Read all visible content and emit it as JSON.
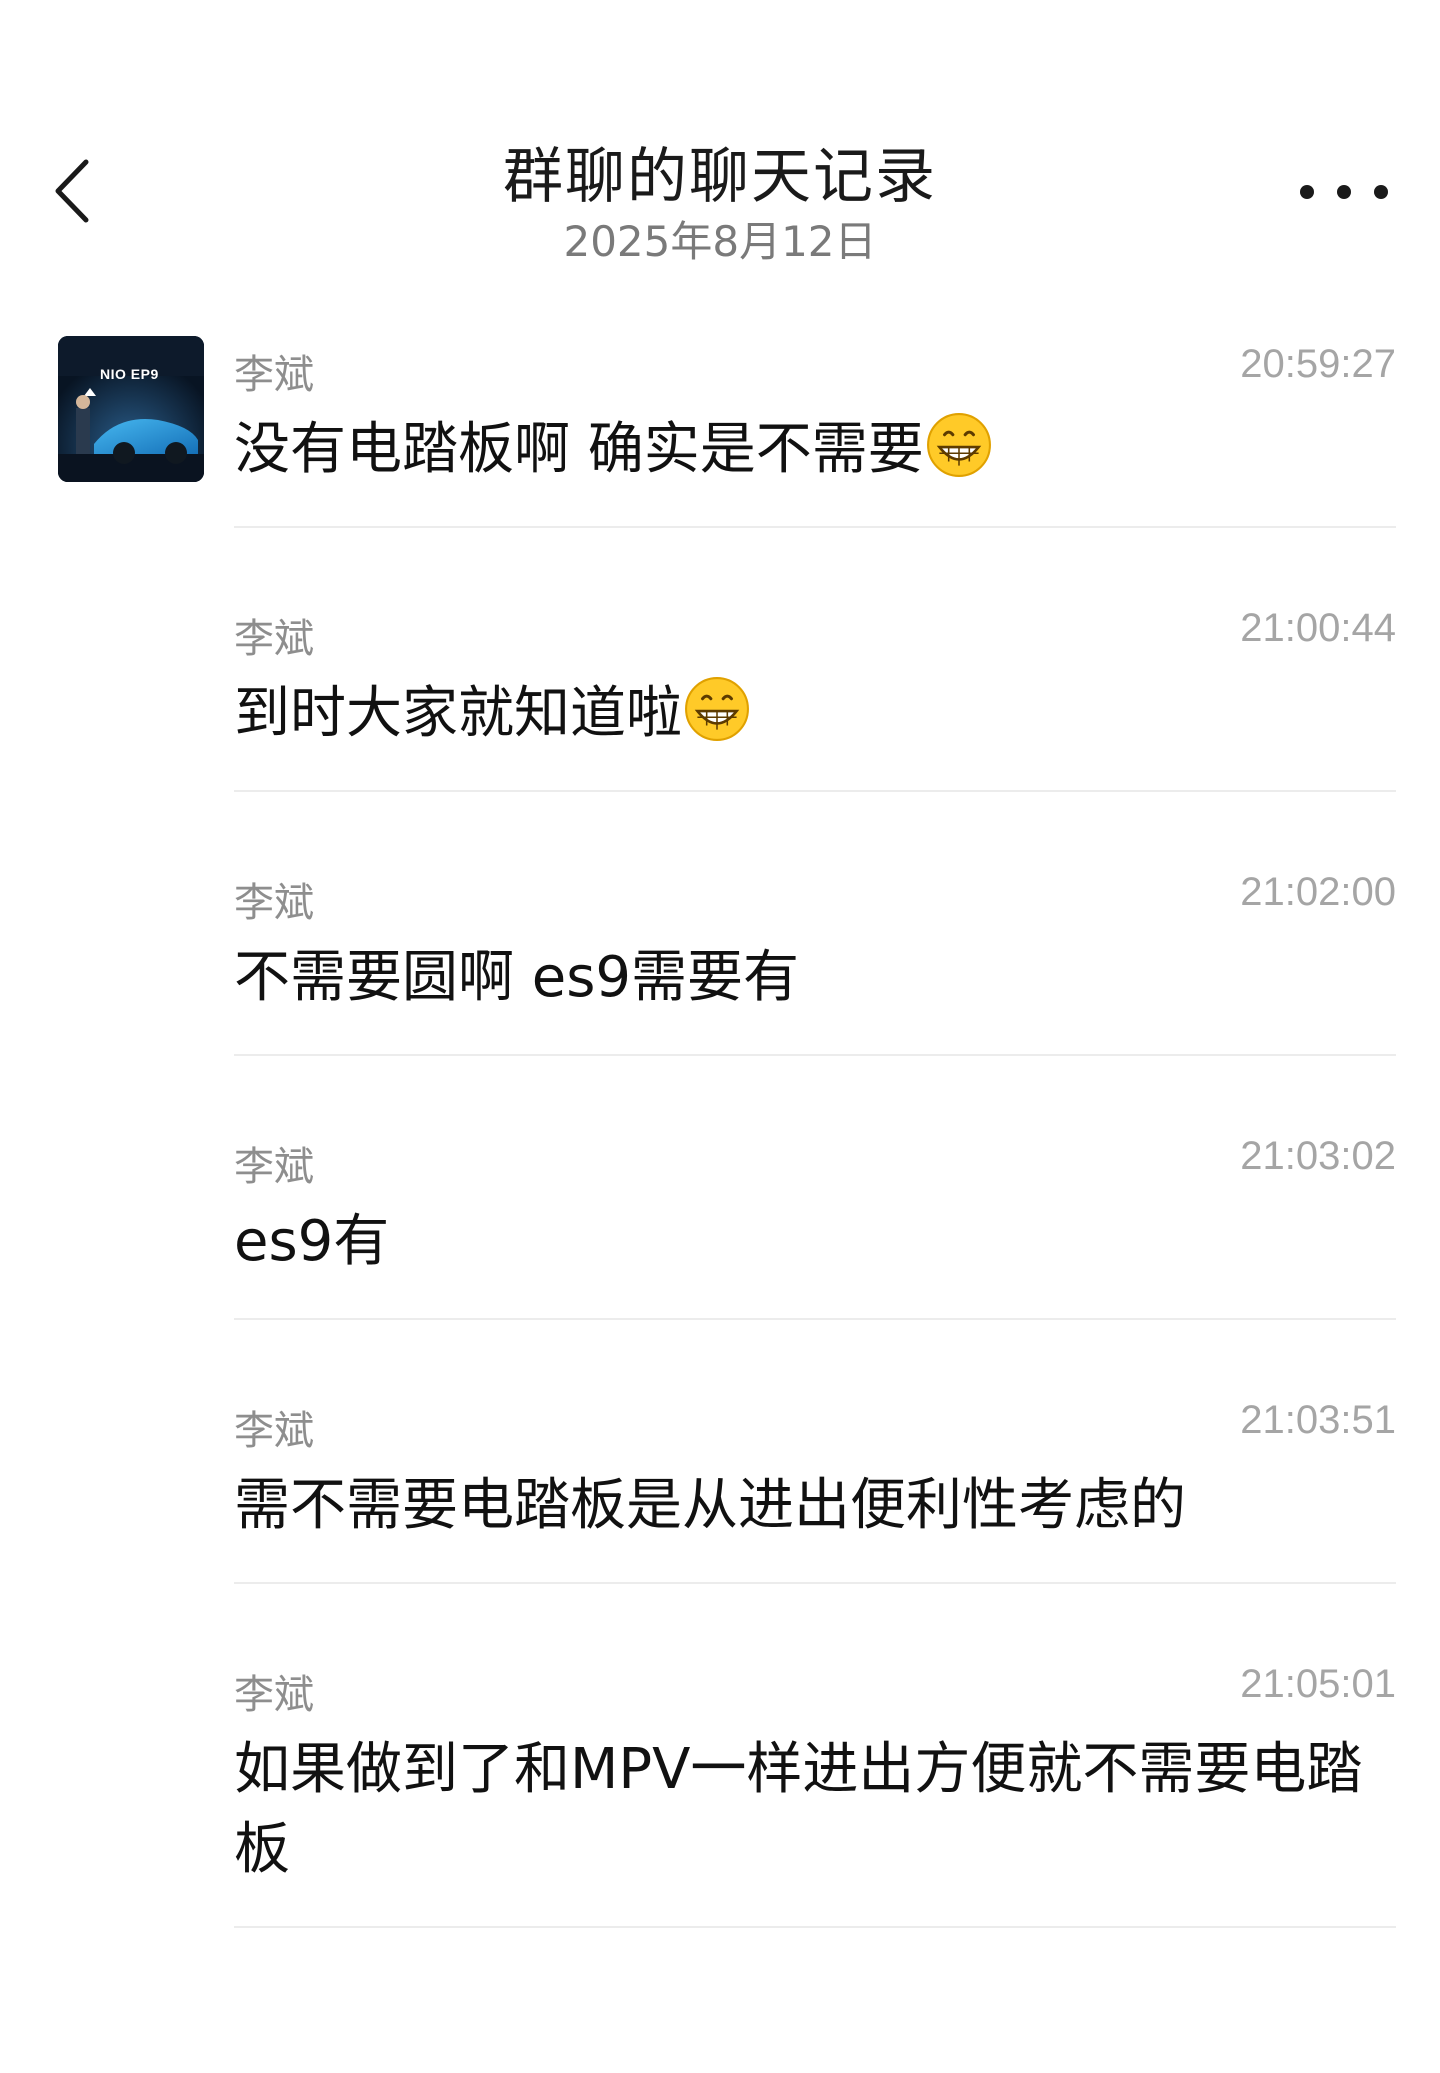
{
  "header": {
    "title": "群聊的聊天记录",
    "date": "2025年8月12日"
  },
  "avatar": {
    "logo_text": "NIO EP9"
  },
  "messages": [
    {
      "sender": "李斌",
      "time": "20:59:27",
      "text": "没有电踏板啊 确实是不需要",
      "emoji": "grinning-face-emoji"
    },
    {
      "sender": "李斌",
      "time": "21:00:44",
      "text": "到时大家就知道啦",
      "emoji": "grinning-face-emoji"
    },
    {
      "sender": "李斌",
      "time": "21:02:00",
      "text": "不需要圆啊 es9需要有",
      "emoji": ""
    },
    {
      "sender": "李斌",
      "time": "21:03:02",
      "text": "es9有",
      "emoji": ""
    },
    {
      "sender": "李斌",
      "time": "21:03:51",
      "text": "需不需要电踏板是从进出便利性考虑的",
      "emoji": ""
    },
    {
      "sender": "李斌",
      "time": "21:05:01",
      "text": "如果做到了和MPV一样进出方便就不需要电踏板",
      "emoji": ""
    }
  ]
}
